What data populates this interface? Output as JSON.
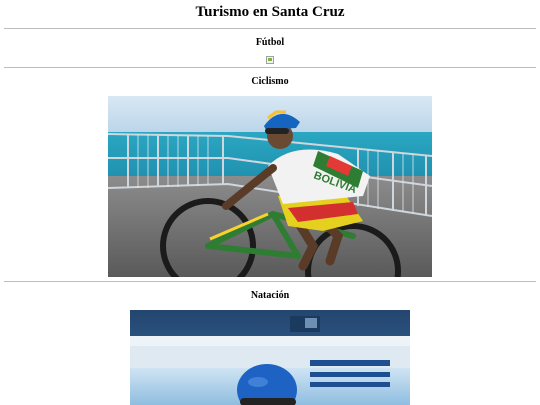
{
  "page": {
    "title": "Turismo en Santa Cruz"
  },
  "sections": [
    {
      "heading": "Fútbol",
      "image": "broken-image"
    },
    {
      "heading": "Ciclismo",
      "image": "cyclist-photo",
      "jersey_text": "BOLIVIA"
    },
    {
      "heading": "Natación",
      "image": "swimmer-photo"
    }
  ]
}
